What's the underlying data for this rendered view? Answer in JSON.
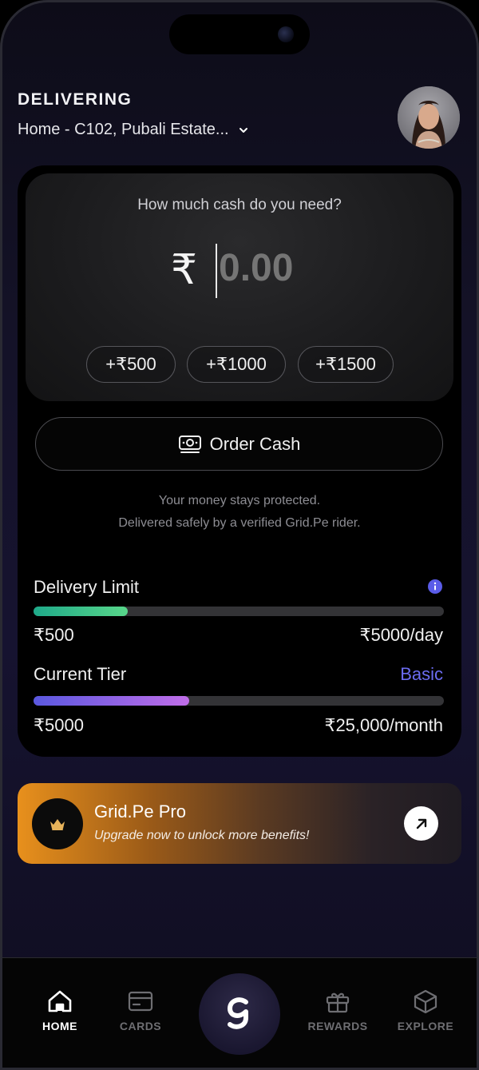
{
  "header": {
    "label": "DELIVERING",
    "address": "Home - C102, Pubali Estate...",
    "avatar_icon": "user-avatar"
  },
  "amount": {
    "question": "How much cash do you need?",
    "currency_symbol": "₹",
    "placeholder": "0.00",
    "quick_add": [
      "+₹500",
      "+₹1000",
      "+₹1500"
    ]
  },
  "order": {
    "button_label": "Order Cash",
    "icon": "cash-icon",
    "protect_line1": "Your money stays protected.",
    "protect_line2": "Delivered safely by a verified Grid.Pe rider."
  },
  "limits": {
    "delivery_label": "Delivery Limit",
    "delivery_min": "₹500",
    "delivery_max": "₹5000/day",
    "delivery_progress": 0.23,
    "tier_label": "Current Tier",
    "tier_value": "Basic",
    "tier_min": "₹5000",
    "tier_max": "₹25,000/month",
    "tier_progress": 0.38
  },
  "promo": {
    "title": "Grid.Pe Pro",
    "subtitle": "Upgrade now to unlock more benefits!",
    "icon": "crown-icon"
  },
  "nav": {
    "items": [
      {
        "label": "HOME",
        "icon": "home-icon",
        "active": true
      },
      {
        "label": "CARDS",
        "icon": "card-icon",
        "active": false
      },
      {
        "label": "REWARDS",
        "icon": "gift-icon",
        "active": false
      },
      {
        "label": "EXPLORE",
        "icon": "cube-icon",
        "active": false
      }
    ],
    "center_icon": "gridpe-logo-icon"
  },
  "colors": {
    "accent": "#6b6cf0",
    "delivery_bar": "#58d68a",
    "tier_bar": "#c06de8",
    "promo_orange": "#e8901c"
  }
}
